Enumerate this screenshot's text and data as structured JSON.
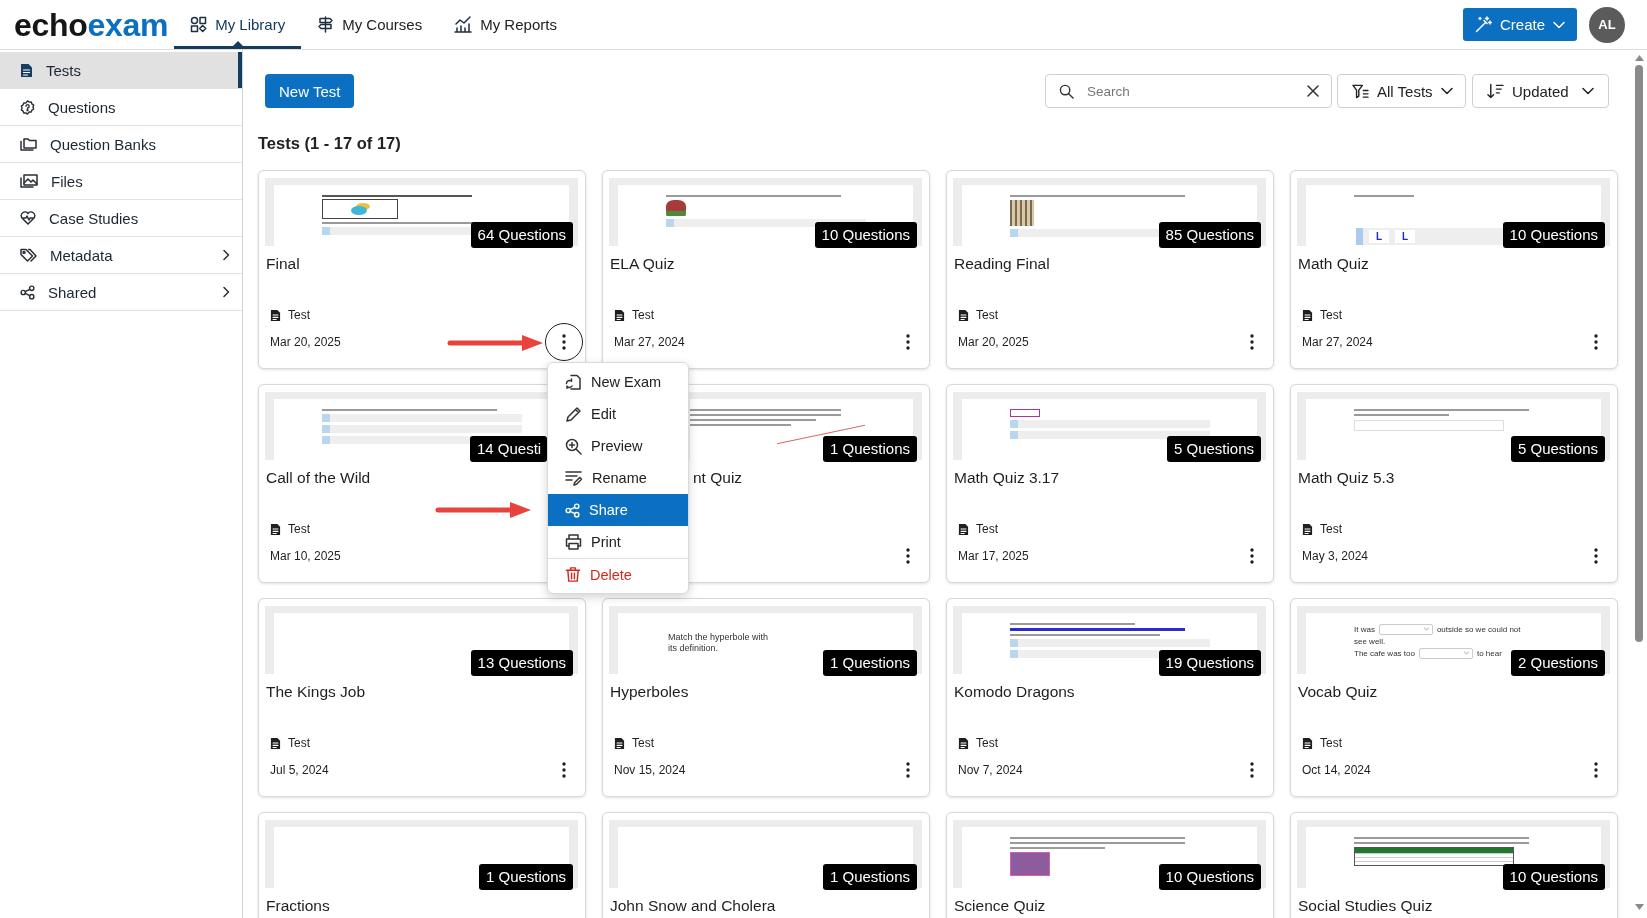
{
  "header": {
    "logo": [
      "echo",
      "exam"
    ],
    "nav": [
      {
        "label": "My Library",
        "selected": true
      },
      {
        "label": "My Courses",
        "selected": false
      },
      {
        "label": "My Reports",
        "selected": false
      }
    ],
    "create_button": "Create",
    "avatar": "AL"
  },
  "sidebar": {
    "items": [
      {
        "label": "Tests",
        "selected": true,
        "submenu": false
      },
      {
        "label": "Questions",
        "selected": false,
        "submenu": false
      },
      {
        "label": "Question Banks",
        "selected": false,
        "submenu": false
      },
      {
        "label": "Files",
        "selected": false,
        "submenu": false
      },
      {
        "label": "Case Studies",
        "selected": false,
        "submenu": false
      },
      {
        "label": "Metadata",
        "selected": false,
        "submenu": true
      },
      {
        "label": "Shared",
        "selected": false,
        "submenu": true
      }
    ]
  },
  "toolbar": {
    "new_button": "New Test",
    "search": {
      "placeholder": "Search"
    },
    "filter": "All Tests",
    "sort": "Updated"
  },
  "heading": "Tests (1 - 17 of 17)",
  "cards": [
    {
      "title": "Final",
      "badge": "64 Questions",
      "type": "Test",
      "date": "Mar 20, 2025",
      "menu_open": true,
      "left_covered": false,
      "right_covered": false,
      "preview": {
        "kind": "figure"
      }
    },
    {
      "title": "ELA Quiz",
      "badge": "10 Questions",
      "type": "Test",
      "date": "Mar 27, 2024",
      "menu_open": false,
      "left_covered": false,
      "right_covered": false,
      "preview": {
        "kind": "image-option"
      }
    },
    {
      "title": "Reading Final",
      "badge": "85 Questions",
      "type": "Test",
      "date": "Mar 20, 2025",
      "menu_open": false,
      "left_covered": false,
      "right_covered": false,
      "preview": {
        "kind": "caged-option"
      }
    },
    {
      "title": "Math Quiz",
      "badge": "10 Questions",
      "type": "Test",
      "date": "Mar 27, 2024",
      "menu_open": false,
      "left_covered": false,
      "right_covered": false,
      "preview": {
        "kind": "tiles",
        "tiles": [
          "L",
          "L"
        ]
      }
    },
    {
      "title": "Call of the Wild",
      "badge": "14 Questi",
      "type": "Test",
      "date": "Mar 10, 2025",
      "menu_open": false,
      "left_covered": false,
      "right_covered": true,
      "preview": {
        "kind": "options"
      }
    },
    {
      "title": "nt Quiz",
      "badge": "1 Questions",
      "menu_open": false,
      "left_covered": true,
      "right_covered": false,
      "preview": {
        "kind": "diagram"
      }
    },
    {
      "title": "Math Quiz 3.17",
      "badge": "5 Questions",
      "type": "Test",
      "date": "Mar 17, 2025",
      "menu_open": false,
      "left_covered": false,
      "right_covered": false,
      "preview": {
        "kind": "boxed-options"
      }
    },
    {
      "title": "Math Quiz 5.3",
      "badge": "5 Questions",
      "type": "Test",
      "date": "May 3, 2024",
      "menu_open": false,
      "left_covered": false,
      "right_covered": false,
      "preview": {
        "kind": "input"
      }
    },
    {
      "title": "The Kings Job",
      "badge": "13 Questions",
      "type": "Test",
      "date": "Jul 5, 2024",
      "menu_open": false,
      "left_covered": false,
      "right_covered": false,
      "preview": {
        "kind": "blank"
      }
    },
    {
      "title": "Hyperboles",
      "badge": "1 Questions",
      "type": "Test",
      "date": "Nov 15, 2024",
      "menu_open": false,
      "left_covered": false,
      "right_covered": false,
      "preview": {
        "kind": "text",
        "text": "Match the hyperbole with its definition."
      }
    },
    {
      "title": "Komodo Dragons",
      "badge": "19 Questions",
      "type": "Test",
      "date": "Nov 7, 2024",
      "menu_open": false,
      "left_covered": false,
      "right_covered": false,
      "preview": {
        "kind": "excerpt-options"
      }
    },
    {
      "title": "Vocab Quiz",
      "badge": "2 Questions",
      "type": "Test",
      "date": "Oct 14, 2024",
      "menu_open": false,
      "left_covered": false,
      "right_covered": false,
      "preview": {
        "kind": "dropdowns",
        "lines": [
          {
            "text": "It was",
            "dropdown": true,
            "after": "outside so we could not"
          },
          {
            "text": "see well.",
            "dropdown": false
          },
          {
            "text": "The cafe was too",
            "dropdown": true,
            "after": "to hear"
          }
        ]
      }
    },
    {
      "title": "Fractions",
      "badge": "1 Questions",
      "menu_open": false,
      "left_covered": false,
      "right_covered": false,
      "preview": {
        "kind": "blank"
      }
    },
    {
      "title": "John Snow and Cholera",
      "badge": "1 Questions",
      "menu_open": false,
      "left_covered": false,
      "right_covered": false,
      "preview": {
        "kind": "blank"
      }
    },
    {
      "title": "Science Quiz",
      "badge": "10 Questions",
      "menu_open": false,
      "left_covered": false,
      "right_covered": false,
      "preview": {
        "kind": "photo-text"
      }
    },
    {
      "title": "Social Studies Quiz",
      "badge": "10 Questions",
      "menu_open": false,
      "left_covered": false,
      "right_covered": false,
      "preview": {
        "kind": "table"
      }
    }
  ],
  "context_menu": {
    "items": [
      {
        "label": "New Exam",
        "selected": false,
        "danger": false
      },
      {
        "label": "Edit",
        "selected": false,
        "danger": false
      },
      {
        "label": "Preview",
        "selected": false,
        "danger": false
      },
      {
        "label": "Rename",
        "selected": false,
        "danger": false
      },
      {
        "label": "Share",
        "selected": true,
        "danger": false
      },
      {
        "label": "Print",
        "selected": false,
        "danger": false
      },
      {
        "label": "Delete",
        "selected": false,
        "danger": true
      }
    ]
  }
}
